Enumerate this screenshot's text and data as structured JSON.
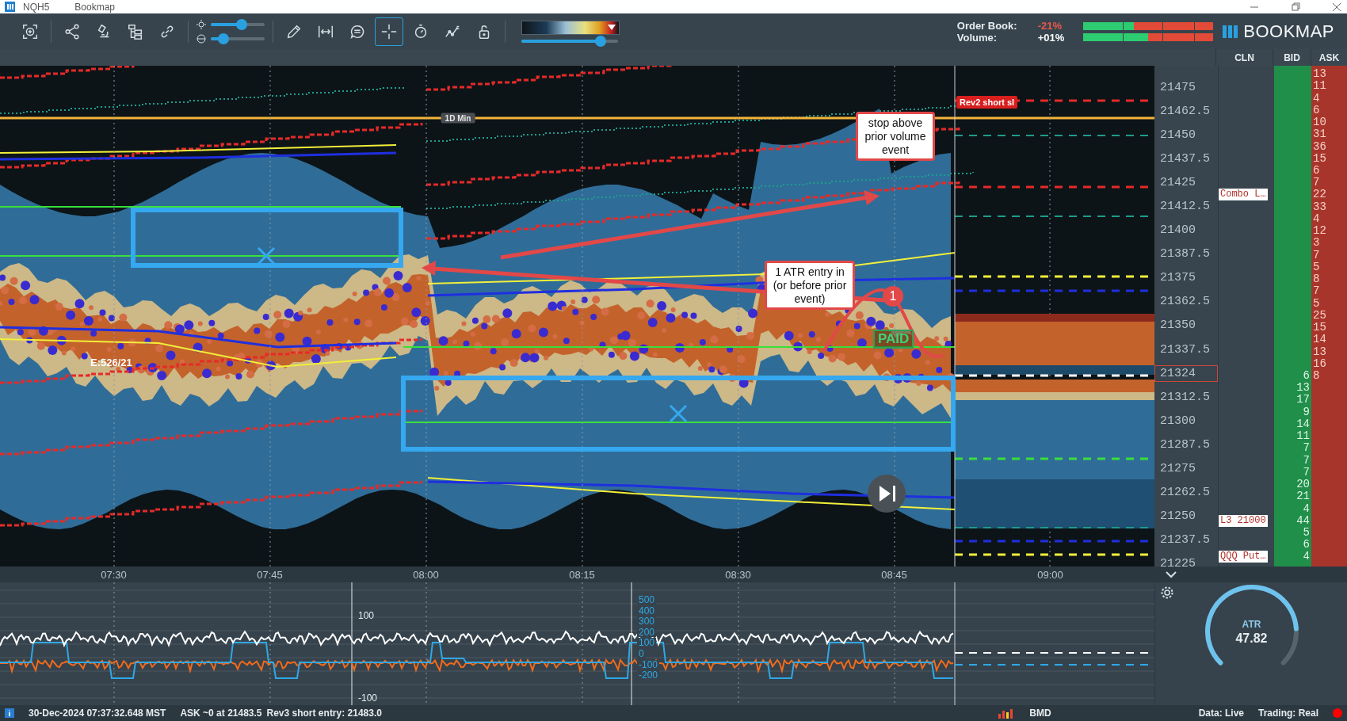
{
  "window": {
    "symbol": "NQH5",
    "app": "Bookmap"
  },
  "toolbar": {
    "tools": [
      {
        "selected": false
      },
      {
        "selected": false
      },
      {
        "selected": false
      },
      {
        "selected": false
      },
      {
        "selected": false
      },
      {
        "selected": false
      },
      {
        "selected": false
      },
      {
        "selected": false
      },
      {
        "selected": true
      },
      {
        "selected": false
      },
      {
        "selected": false
      },
      {
        "selected": false
      }
    ],
    "sliders": [
      {
        "level": 0.58
      },
      {
        "level": 0.24
      }
    ],
    "color_map": {
      "level": 0.82
    }
  },
  "sentiment": [
    {
      "label": "Order Book:",
      "value": "-21%",
      "color": "#e8584a",
      "level": 0.39
    },
    {
      "label": "Volume:",
      "value": "+01%",
      "color": "#ffffff",
      "level": 0.5
    }
  ],
  "logo": {
    "text": "BOOKMAP"
  },
  "columns": [
    "CLN",
    "BID",
    "ASK"
  ],
  "chart": {
    "day_min_label": "1D Min",
    "order_tag": "Rev2 short sl",
    "event_label": "E:526/21",
    "paid_label": "PAID",
    "marker": "1",
    "callouts": [
      "stop above prior volume event",
      "1 ATR entry in (or before prior event)"
    ]
  },
  "price_axis": [
    {
      "text": "21475",
      "current": false
    },
    {
      "text": "21462.5",
      "current": false
    },
    {
      "text": "21450",
      "current": false
    },
    {
      "text": "21437.5",
      "current": false
    },
    {
      "text": "21425",
      "current": false
    },
    {
      "text": "21412.5",
      "current": false
    },
    {
      "text": "21400",
      "current": false
    },
    {
      "text": "21387.5",
      "current": false
    },
    {
      "text": "21375",
      "current": false
    },
    {
      "text": "21362.5",
      "current": false
    },
    {
      "text": "21350",
      "current": false
    },
    {
      "text": "21337.5",
      "current": false
    },
    {
      "text": "21324",
      "current": true
    },
    {
      "text": "21312.5",
      "current": false
    },
    {
      "text": "21300",
      "current": false
    },
    {
      "text": "21287.5",
      "current": false
    },
    {
      "text": "21275",
      "current": false
    },
    {
      "text": "21262.5",
      "current": false
    },
    {
      "text": "21250",
      "current": false
    },
    {
      "text": "21237.5",
      "current": false
    },
    {
      "text": "21225",
      "current": false
    }
  ],
  "book": [
    {
      "ask": "13"
    },
    {
      "ask": "11"
    },
    {
      "ask": "4"
    },
    {
      "ask": "6"
    },
    {
      "ask": "10"
    },
    {
      "ask": "31"
    },
    {
      "ask": "36"
    },
    {
      "ask": "15"
    },
    {
      "ask": "6"
    },
    {
      "ask": "7"
    },
    {
      "ask": "22",
      "cln": "Combo L…"
    },
    {
      "ask": "33"
    },
    {
      "ask": "4"
    },
    {
      "ask": "12"
    },
    {
      "ask": "3"
    },
    {
      "ask": "7"
    },
    {
      "ask": "5"
    },
    {
      "ask": "8"
    },
    {
      "ask": "7"
    },
    {
      "ask": "5"
    },
    {
      "ask": "25"
    },
    {
      "ask": "15"
    },
    {
      "ask": "14"
    },
    {
      "ask": "13"
    },
    {
      "ask": "16"
    },
    {
      "ask": "8",
      "bid": "6"
    },
    {
      "bid": "13"
    },
    {
      "bid": "17"
    },
    {
      "bid": "9"
    },
    {
      "bid": "14"
    },
    {
      "bid": "11"
    },
    {
      "bid": "7"
    },
    {
      "bid": "7"
    },
    {
      "bid": "7"
    },
    {
      "bid": "20"
    },
    {
      "bid": "21"
    },
    {
      "bid": "4"
    },
    {
      "bid": "44",
      "cln": "L3 21000"
    },
    {
      "bid": "5"
    },
    {
      "bid": "6"
    },
    {
      "bid": "4",
      "cln": "QQQ Put…"
    }
  ],
  "time_axis": [
    "07:30",
    "07:45",
    "08:00",
    "08:15",
    "08:30",
    "08:45",
    "09:00"
  ],
  "indicator": {
    "left_ticks": [
      "100",
      "-100"
    ],
    "right_ticks": [
      "500",
      "400",
      "300",
      "200",
      "100",
      "0",
      "-100",
      "-200"
    ]
  },
  "atr": {
    "label": "ATR",
    "value": "47.82"
  },
  "status_bar": {
    "timestamp": "30-Dec-2024 07:37:32.648 MST",
    "last_trade": "ASK ~0 at 21483.5",
    "order": "Rev3 short entry: 21483.0",
    "exchange": "BMD",
    "data": "Data: Live",
    "trading": "Trading: Real"
  }
}
